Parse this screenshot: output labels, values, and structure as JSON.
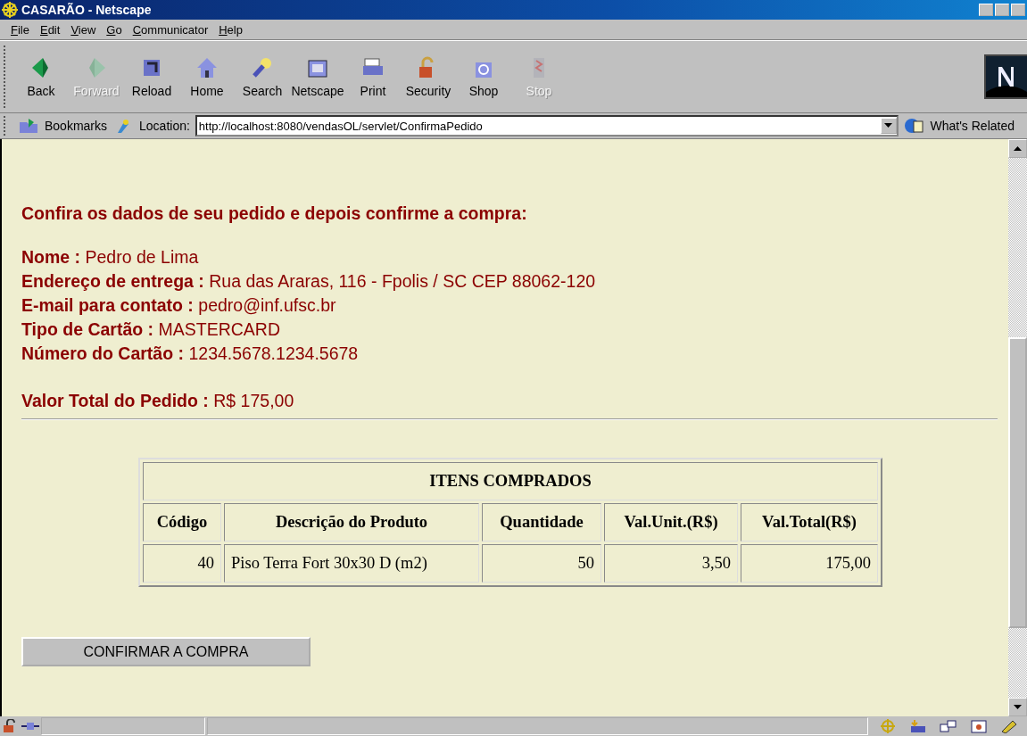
{
  "window": {
    "title": "CASARÃO - Netscape"
  },
  "menu": [
    "File",
    "Edit",
    "View",
    "Go",
    "Communicator",
    "Help"
  ],
  "toolbar": [
    {
      "label": "Back",
      "disabled": false
    },
    {
      "label": "Forward",
      "disabled": true
    },
    {
      "label": "Reload",
      "disabled": false
    },
    {
      "label": "Home",
      "disabled": false
    },
    {
      "label": "Search",
      "disabled": false
    },
    {
      "label": "Netscape",
      "disabled": false
    },
    {
      "label": "Print",
      "disabled": false
    },
    {
      "label": "Security",
      "disabled": false
    },
    {
      "label": "Shop",
      "disabled": false
    },
    {
      "label": "Stop",
      "disabled": true
    }
  ],
  "location_bar": {
    "bookmarks": "Bookmarks",
    "label": "Location:",
    "url": "http://localhost:8080/vendasOL/servlet/ConfirmaPedido",
    "related": "What's Related"
  },
  "page": {
    "heading": "Confira os dados de seu pedido e depois confirme a compra:",
    "fields": [
      {
        "label": "Nome :",
        "value": "Pedro de Lima"
      },
      {
        "label": "Endereço de entrega :",
        "value": "Rua das Araras, 116 - Fpolis / SC CEP 88062-120"
      },
      {
        "label": "E-mail para contato :",
        "value": "pedro@inf.ufsc.br"
      },
      {
        "label": "Tipo de Cartão :",
        "value": "MASTERCARD"
      },
      {
        "label": "Número do Cartão :",
        "value": "1234.5678.1234.5678"
      }
    ],
    "total": {
      "label": "Valor Total do Pedido :",
      "value": "R$ 175,00"
    },
    "table": {
      "title": "ITENS COMPRADOS",
      "columns": [
        "Código",
        "Descrição do Produto",
        "Quantidade",
        "Val.Unit.(R$)",
        "Val.Total(R$)"
      ],
      "rows": [
        [
          "40",
          "Piso Terra Fort 30x30 D (m2)",
          "50",
          "3,50",
          "175,00"
        ]
      ]
    },
    "confirm_button": "CONFIRMAR A COMPRA"
  }
}
